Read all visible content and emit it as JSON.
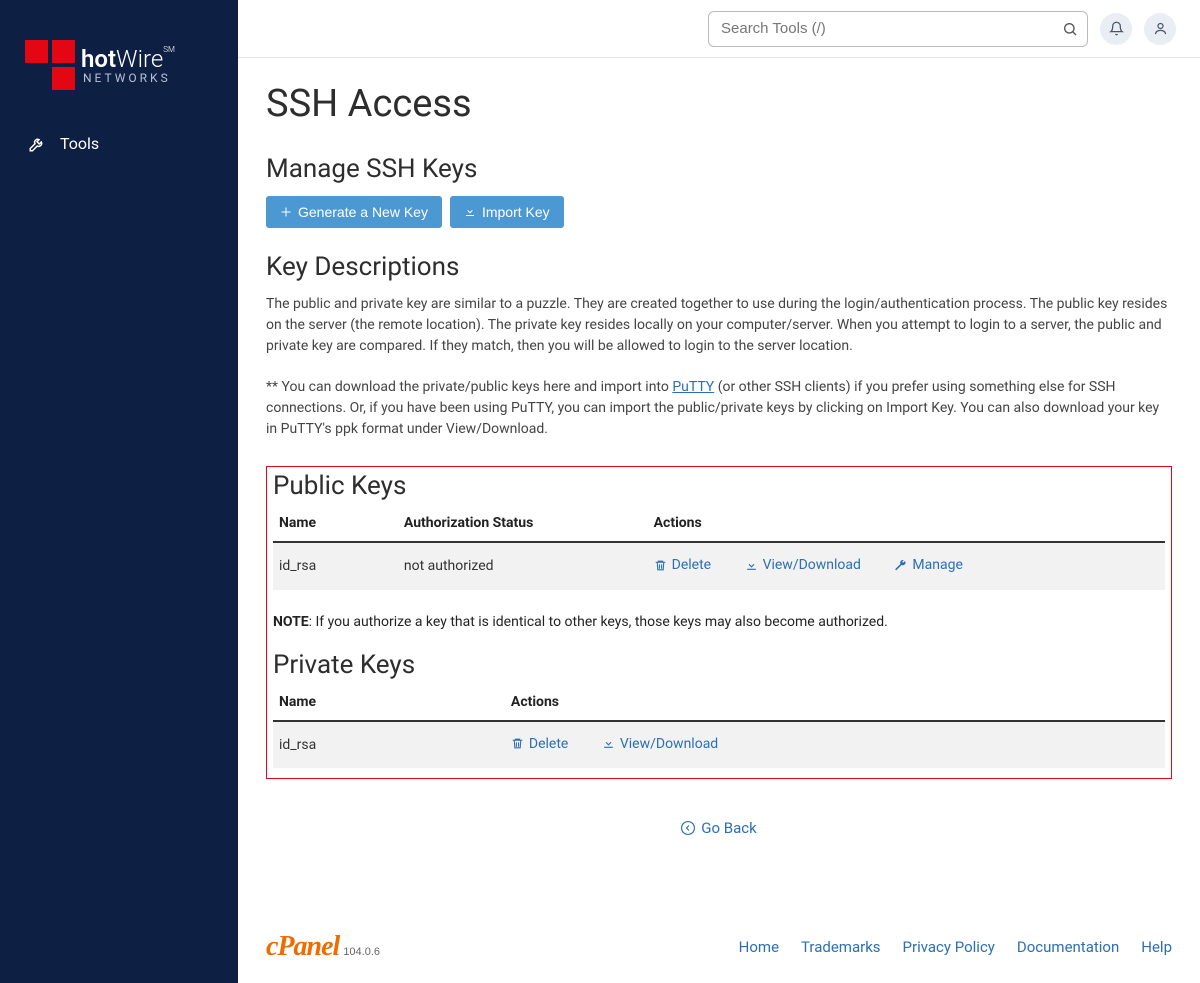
{
  "brand": {
    "name_bold": "hot",
    "name_rest": "Wire",
    "sm": "SM",
    "subtitle": "NETWORKS"
  },
  "sidebar": {
    "items": [
      {
        "label": "Tools"
      }
    ]
  },
  "search": {
    "placeholder": "Search Tools (/)"
  },
  "page": {
    "title": "SSH Access"
  },
  "manage": {
    "heading": "Manage SSH Keys",
    "generate_btn": "Generate a New Key",
    "import_btn": "Import Key"
  },
  "keydesc": {
    "heading": "Key Descriptions",
    "p1": "The public and private key are similar to a puzzle. They are created together to use during the login/authentication process. The public key resides on the server (the remote location). The private key resides locally on your computer/server. When you attempt to login to a server, the public and private key are compared. If they match, then you will be allowed to login to the server location.",
    "p2_pre": "** You can download the private/public keys here and import into ",
    "p2_link": "PuTTY",
    "p2_post": " (or other SSH clients) if you prefer using something else for SSH connections. Or, if you have been using PuTTY, you can import the public/private keys by clicking on Import Key. You can also download your key in PuTTY's ppk format under View/Download."
  },
  "public_keys": {
    "heading": "Public Keys",
    "cols": {
      "name": "Name",
      "auth": "Authorization Status",
      "actions": "Actions"
    },
    "rows": [
      {
        "name": "id_rsa",
        "auth": "not authorized",
        "delete": "Delete",
        "view": "View/Download",
        "manage": "Manage"
      }
    ],
    "note_label": "NOTE",
    "note_text": ": If you authorize a key that is identical to other keys, those keys may also become authorized."
  },
  "private_keys": {
    "heading": "Private Keys",
    "cols": {
      "name": "Name",
      "actions": "Actions"
    },
    "rows": [
      {
        "name": "id_rsa",
        "delete": "Delete",
        "view": "View/Download"
      }
    ]
  },
  "goback": "Go Back",
  "footer": {
    "cpanel": "cPanel",
    "version": "104.0.6",
    "links": {
      "home": "Home",
      "trademarks": "Trademarks",
      "privacy": "Privacy Policy",
      "docs": "Documentation",
      "help": "Help"
    }
  }
}
